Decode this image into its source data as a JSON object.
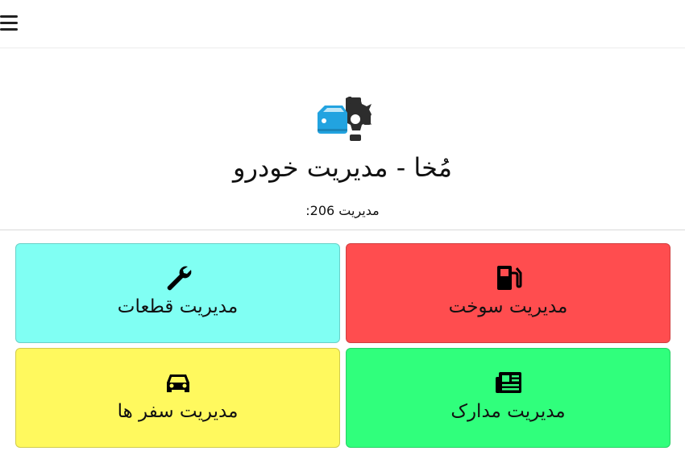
{
  "header": {
    "menu_icon": "hamburger-menu-icon"
  },
  "hero": {
    "logo_icon": "car-gear-logo-icon",
    "title": "مُخا - مدیریت خودرو",
    "subtitle": "مدیریت 206:"
  },
  "tiles": [
    {
      "label": "مدیریت قطعات",
      "icon": "wrench-icon",
      "color": "#80fff3"
    },
    {
      "label": "مدیریت سوخت",
      "icon": "gas-pump-icon",
      "color": "#ff4d4f"
    },
    {
      "label": "مدیریت سفر ها",
      "icon": "car-icon",
      "color": "#fff95e"
    },
    {
      "label": "مدیریت مدارک",
      "icon": "newspaper-icon",
      "color": "#30ff7c"
    }
  ],
  "colors": {
    "logo_blue": "#22a3e0",
    "logo_dark": "#2d2d2d"
  }
}
